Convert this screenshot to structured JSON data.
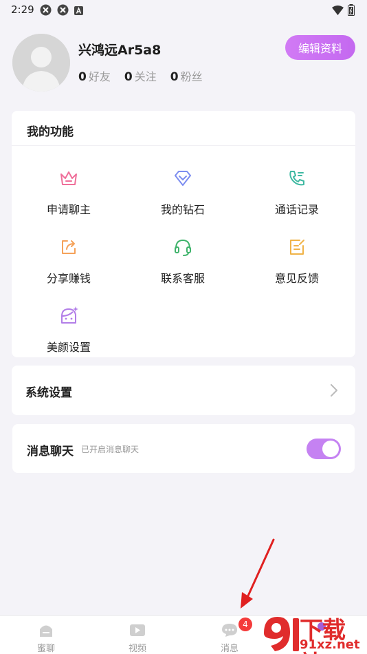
{
  "status_bar": {
    "time": "2:29"
  },
  "profile": {
    "username": "兴鸿远Ar5a8",
    "edit_button": "编辑资料",
    "stats": [
      {
        "count": "0",
        "label": "好友"
      },
      {
        "count": "0",
        "label": "关注"
      },
      {
        "count": "0",
        "label": "粉丝"
      }
    ]
  },
  "functions": {
    "title": "我的功能",
    "items": [
      {
        "label": "申请聊主",
        "icon": "crown-icon"
      },
      {
        "label": "我的钻石",
        "icon": "diamond-icon"
      },
      {
        "label": "通话记录",
        "icon": "phone-icon"
      },
      {
        "label": "分享赚钱",
        "icon": "share-icon"
      },
      {
        "label": "联系客服",
        "icon": "headset-icon"
      },
      {
        "label": "意见反馈",
        "icon": "feedback-icon"
      },
      {
        "label": "美颜设置",
        "icon": "beauty-icon"
      }
    ]
  },
  "settings": {
    "label": "系统设置"
  },
  "chat": {
    "label": "消息聊天",
    "description": "已开启消息聊天",
    "enabled": true
  },
  "tab_bar": {
    "tabs": [
      {
        "label": "蜜聊",
        "icon": "home-icon"
      },
      {
        "label": "视频",
        "icon": "video-icon"
      },
      {
        "label": "消息",
        "icon": "message-icon"
      }
    ],
    "message_badge": "4"
  },
  "watermark": {
    "line1": "下载站",
    "line2": "91xz.net"
  },
  "colors": {
    "accent": "#c582f2",
    "badge": "#f43b3b",
    "watermark": "#e02c2c"
  }
}
